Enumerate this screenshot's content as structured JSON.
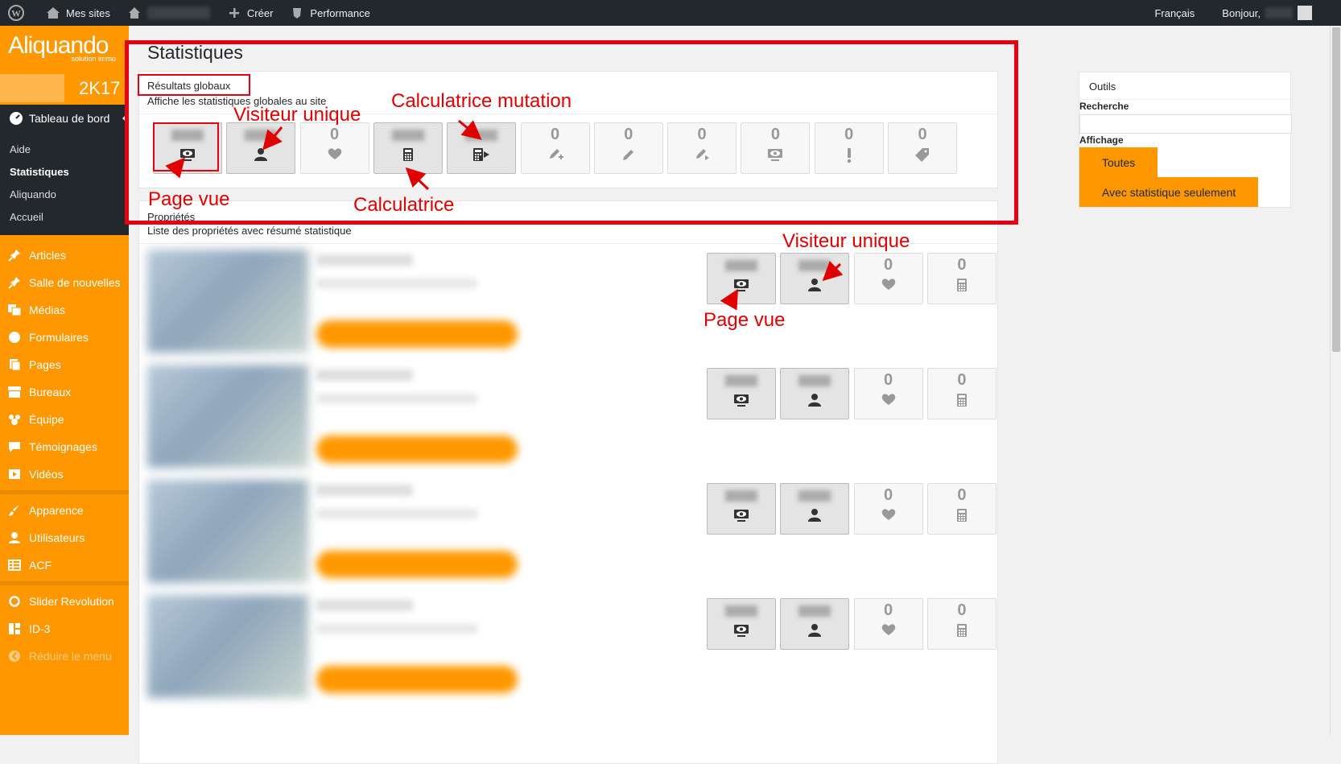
{
  "adminbar": {
    "my_sites": "Mes sites",
    "create": "Créer",
    "performance": "Performance",
    "language": "Français",
    "greeting": "Bonjour,"
  },
  "sidebar": {
    "logo": "Aliquando",
    "logo_sub": "solution immo",
    "year": "2K17",
    "dashboard": "Tableau de bord",
    "submenu": [
      "Aide",
      "Statistiques",
      "Aliquando",
      "Accueil"
    ],
    "items": [
      "Articles",
      "Salle de nouvelles",
      "Médias",
      "Formulaires",
      "Pages",
      "Bureaux",
      "Équipe",
      "Témoignages",
      "Vidéos"
    ],
    "items2": [
      "Apparence",
      "Utilisateurs",
      "ACF"
    ],
    "items3": [
      "Slider Revolution",
      "ID-3",
      "Réduire le menu"
    ]
  },
  "main": {
    "title": "Statistiques",
    "global_title": "Résultats globaux",
    "global_desc": "Affiche les statistiques globales au site",
    "global_stats": [
      "",
      "",
      "0",
      "",
      "",
      "0",
      "0",
      "0",
      "0",
      "0",
      "0"
    ],
    "props_title": "Propriétés",
    "props_desc": "Liste des propriétés avec résumé statistique",
    "prop_stats_zero": "0"
  },
  "annotations": {
    "visiteur_unique": "Visiteur unique",
    "calc_mutation": "Calculatrice mutation",
    "page_vue": "Page vue",
    "calculatrice": "Calculatrice",
    "visiteur_unique_2": "Visiteur unique",
    "page_vue_2": "Page vue"
  },
  "tools": {
    "title": "Outils",
    "search_label": "Recherche",
    "display_label": "Affichage",
    "all": "Toutes",
    "with_stats": "Avec statistique seulement"
  },
  "colors": {
    "accent": "#ff9800",
    "adminbar": "#23282d",
    "annotation": "#e60012"
  }
}
